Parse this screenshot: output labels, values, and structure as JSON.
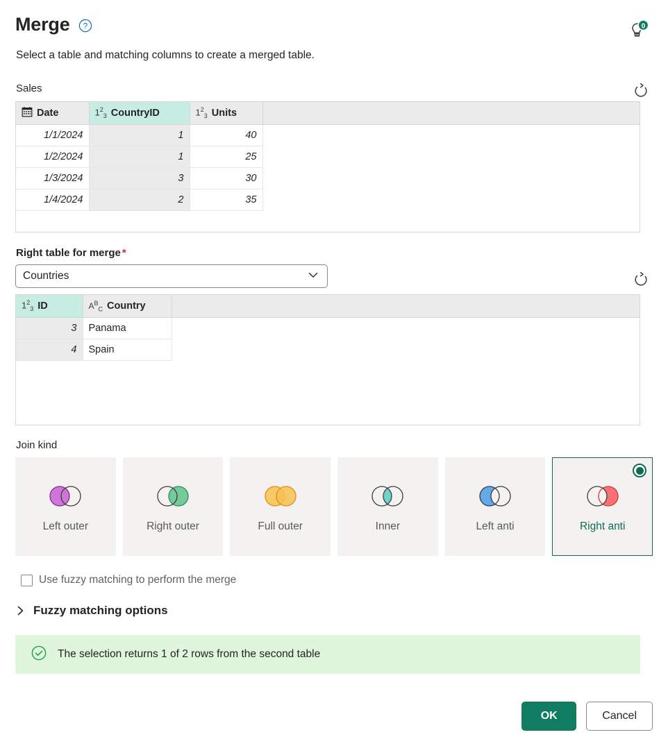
{
  "header": {
    "title": "Merge",
    "help_icon": "question-circle-icon",
    "subtitle": "Select a table and matching columns to create a merged table.",
    "tip_icon": "lightbulb-icon",
    "tip_badge": "0"
  },
  "left_table": {
    "label": "Sales",
    "refresh_icon": "refresh-icon",
    "columns": [
      {
        "name": "Date",
        "type_icon": "calendar-icon",
        "selected": false,
        "align": "right"
      },
      {
        "name": "CountryID",
        "type_icon": "number-icon",
        "selected": true,
        "align": "right"
      },
      {
        "name": "Units",
        "type_icon": "number-icon",
        "selected": false,
        "align": "right"
      }
    ],
    "rows": [
      [
        "1/1/2024",
        "1",
        "40"
      ],
      [
        "1/2/2024",
        "1",
        "25"
      ],
      [
        "1/3/2024",
        "3",
        "30"
      ],
      [
        "1/4/2024",
        "2",
        "35"
      ]
    ]
  },
  "right_table_picker": {
    "label": "Right table for merge",
    "required_marker": "*",
    "selected_value": "Countries",
    "chevron_icon": "chevron-down-icon",
    "options": [
      "Countries"
    ]
  },
  "right_table": {
    "refresh_icon": "refresh-icon",
    "columns": [
      {
        "name": "ID",
        "type_icon": "number-icon",
        "selected": true,
        "align": "right"
      },
      {
        "name": "Country",
        "type_icon": "text-icon",
        "selected": false,
        "align": "left"
      }
    ],
    "rows": [
      [
        "3",
        "Panama"
      ],
      [
        "4",
        "Spain"
      ]
    ]
  },
  "join_kind": {
    "label": "Join kind",
    "selected": "Right anti",
    "options": [
      {
        "label": "Left outer",
        "venn": "left-filled",
        "color": "#c455d1",
        "selected": false
      },
      {
        "label": "Right outer",
        "venn": "right-filled",
        "color": "#5fc28b",
        "selected": false
      },
      {
        "label": "Full outer",
        "venn": "both-filled",
        "color": "#f7c150",
        "selected": false
      },
      {
        "label": "Inner",
        "venn": "intersection-filled",
        "color": "#5ecfc6",
        "selected": false
      },
      {
        "label": "Left anti",
        "venn": "left-only",
        "color": "#5ba3e8",
        "selected": false
      },
      {
        "label": "Right anti",
        "venn": "right-only",
        "color": "#f9696e",
        "selected": true
      }
    ]
  },
  "fuzzy": {
    "checkbox_label": "Use fuzzy matching to perform the merge",
    "checked": false,
    "expander_label": "Fuzzy matching options",
    "expander_icon": "chevron-right-icon",
    "expanded": false
  },
  "status": {
    "icon": "check-circle-icon",
    "message": "The selection returns 1 of 2 rows from the second table"
  },
  "footer": {
    "ok_label": "OK",
    "cancel_label": "Cancel"
  },
  "colors": {
    "accent": "#107c61",
    "selected_header": "#c7ece2",
    "status_bg": "#dff6dd",
    "required": "#c4314b",
    "help_blue": "#0f6cbd"
  }
}
